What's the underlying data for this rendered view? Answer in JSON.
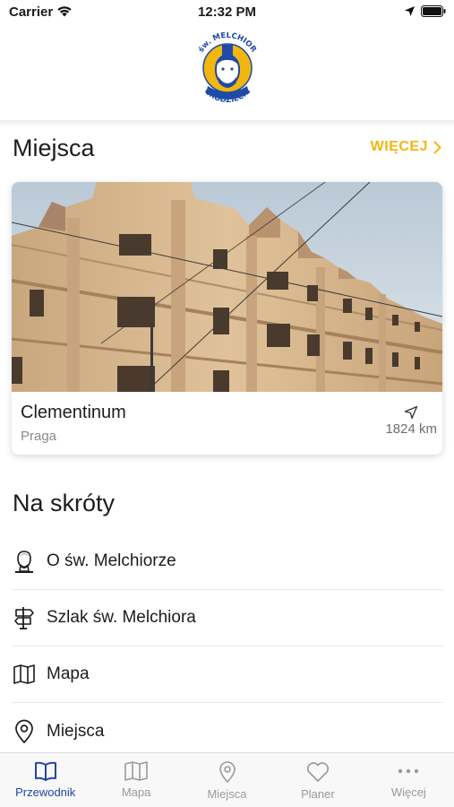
{
  "status_bar": {
    "carrier": "Carrier",
    "time": "12:32 PM"
  },
  "header": {
    "logo_text_top": "św. MELCHIOR",
    "logo_text_bottom": "GRODZIECKI"
  },
  "places": {
    "title": "Miejsca",
    "more_label": "WIĘCEJ",
    "card": {
      "name": "Clementinum",
      "city": "Praga",
      "distance": "1824 km"
    }
  },
  "shortcuts": {
    "title": "Na skróty",
    "items": [
      {
        "label": "O św. Melchiorze",
        "icon": "saint-portrait-icon"
      },
      {
        "label": "Szlak św. Melchiora",
        "icon": "signpost-icon"
      },
      {
        "label": "Mapa",
        "icon": "map-icon"
      },
      {
        "label": "Miejsca",
        "icon": "location-pin-icon"
      }
    ]
  },
  "tab_bar": {
    "tabs": [
      {
        "label": "Przewodnik",
        "icon": "book-icon",
        "active": true
      },
      {
        "label": "Mapa",
        "icon": "map-icon",
        "active": false
      },
      {
        "label": "Miejsca",
        "icon": "location-pin-icon",
        "active": false
      },
      {
        "label": "Planer",
        "icon": "heart-icon",
        "active": false
      },
      {
        "label": "Więcej",
        "icon": "more-dots-icon",
        "active": false
      }
    ]
  },
  "colors": {
    "accent": "#f2b70e",
    "tab_active": "#2145a3",
    "tab_inactive": "#9a9a9e",
    "logo_blue": "#1f4aa8"
  }
}
